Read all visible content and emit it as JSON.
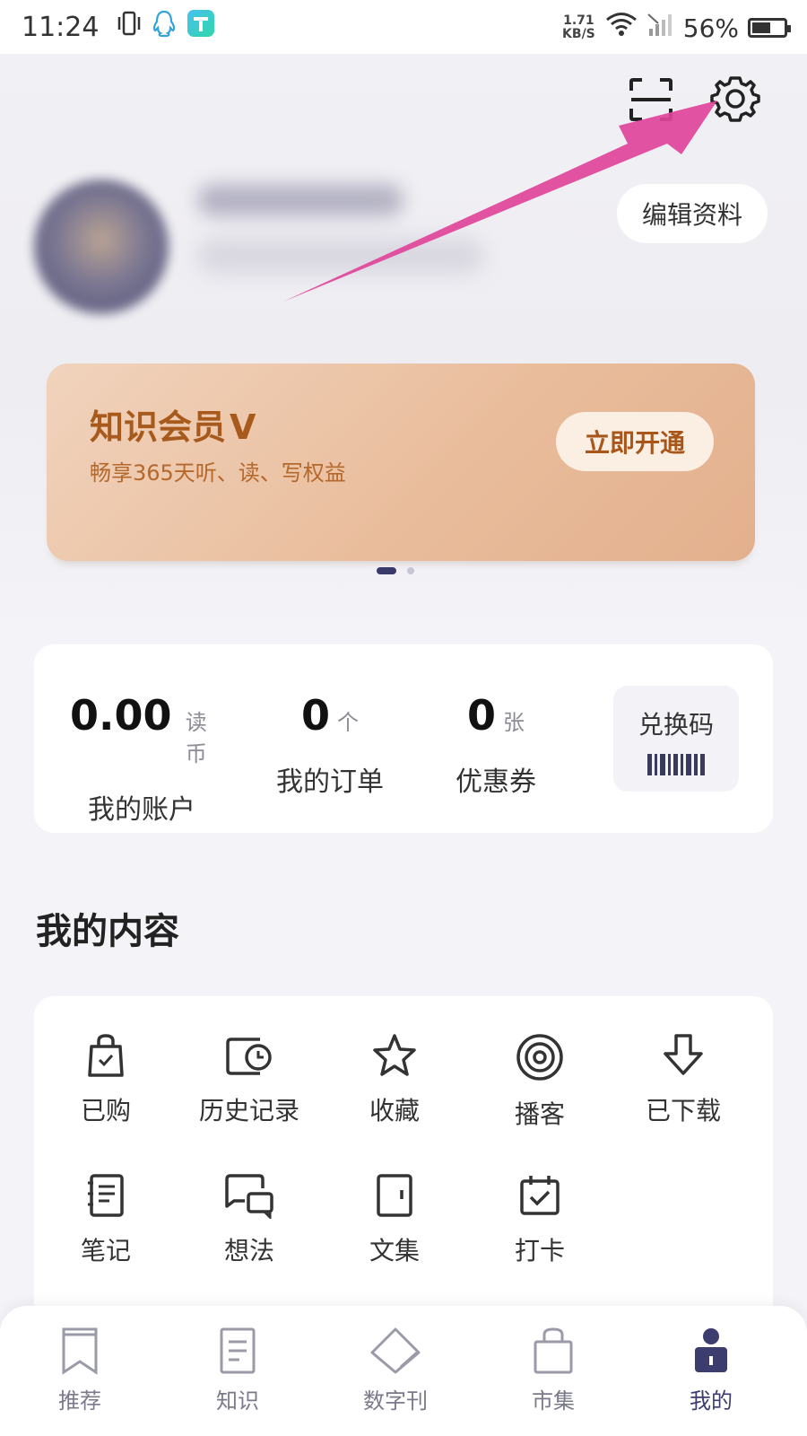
{
  "status_bar": {
    "time": "11:24",
    "network_speed_value": "1.71",
    "network_speed_unit": "KB/S",
    "battery": "56%"
  },
  "header": {
    "edit_profile_label": "编辑资料"
  },
  "member_banner": {
    "title": "知识会员",
    "title_badge": "V",
    "subtitle": "畅享365天听、读、写权益",
    "cta_label": "立即开通",
    "page_count": 2,
    "active_page": 1
  },
  "stats": {
    "account_value": "0.00",
    "account_unit": "读币",
    "account_label": "我的账户",
    "orders_value": "0",
    "orders_unit": "个",
    "orders_label": "我的订单",
    "coupons_value": "0",
    "coupons_unit": "张",
    "coupons_label": "优惠券",
    "redeem_label": "兑换码"
  },
  "my_content": {
    "section_title": "我的内容",
    "items": [
      {
        "label": "已购",
        "icon": "shopping-bag-check-icon"
      },
      {
        "label": "历史记录",
        "icon": "history-clock-icon"
      },
      {
        "label": "收藏",
        "icon": "star-icon"
      },
      {
        "label": "播客",
        "icon": "podcast-icon"
      },
      {
        "label": "已下载",
        "icon": "download-arrow-icon"
      },
      {
        "label": "笔记",
        "icon": "notebook-icon"
      },
      {
        "label": "想法",
        "icon": "thought-bubble-icon"
      },
      {
        "label": "文集",
        "icon": "collection-door-icon"
      },
      {
        "label": "打卡",
        "icon": "calendar-check-icon"
      }
    ]
  },
  "tabbar": {
    "tabs": [
      {
        "label": "推荐",
        "icon": "bookmark-icon"
      },
      {
        "label": "知识",
        "icon": "document-icon"
      },
      {
        "label": "数字刊",
        "icon": "diamond-icon"
      },
      {
        "label": "市集",
        "icon": "shopping-bag-icon"
      },
      {
        "label": "我的",
        "icon": "profile-icon"
      }
    ],
    "active_tab": "我的"
  },
  "colors": {
    "accent_dark": "#3c3c6e",
    "member_text": "#a75a1c",
    "annotation_arrow": "#e0449a"
  }
}
